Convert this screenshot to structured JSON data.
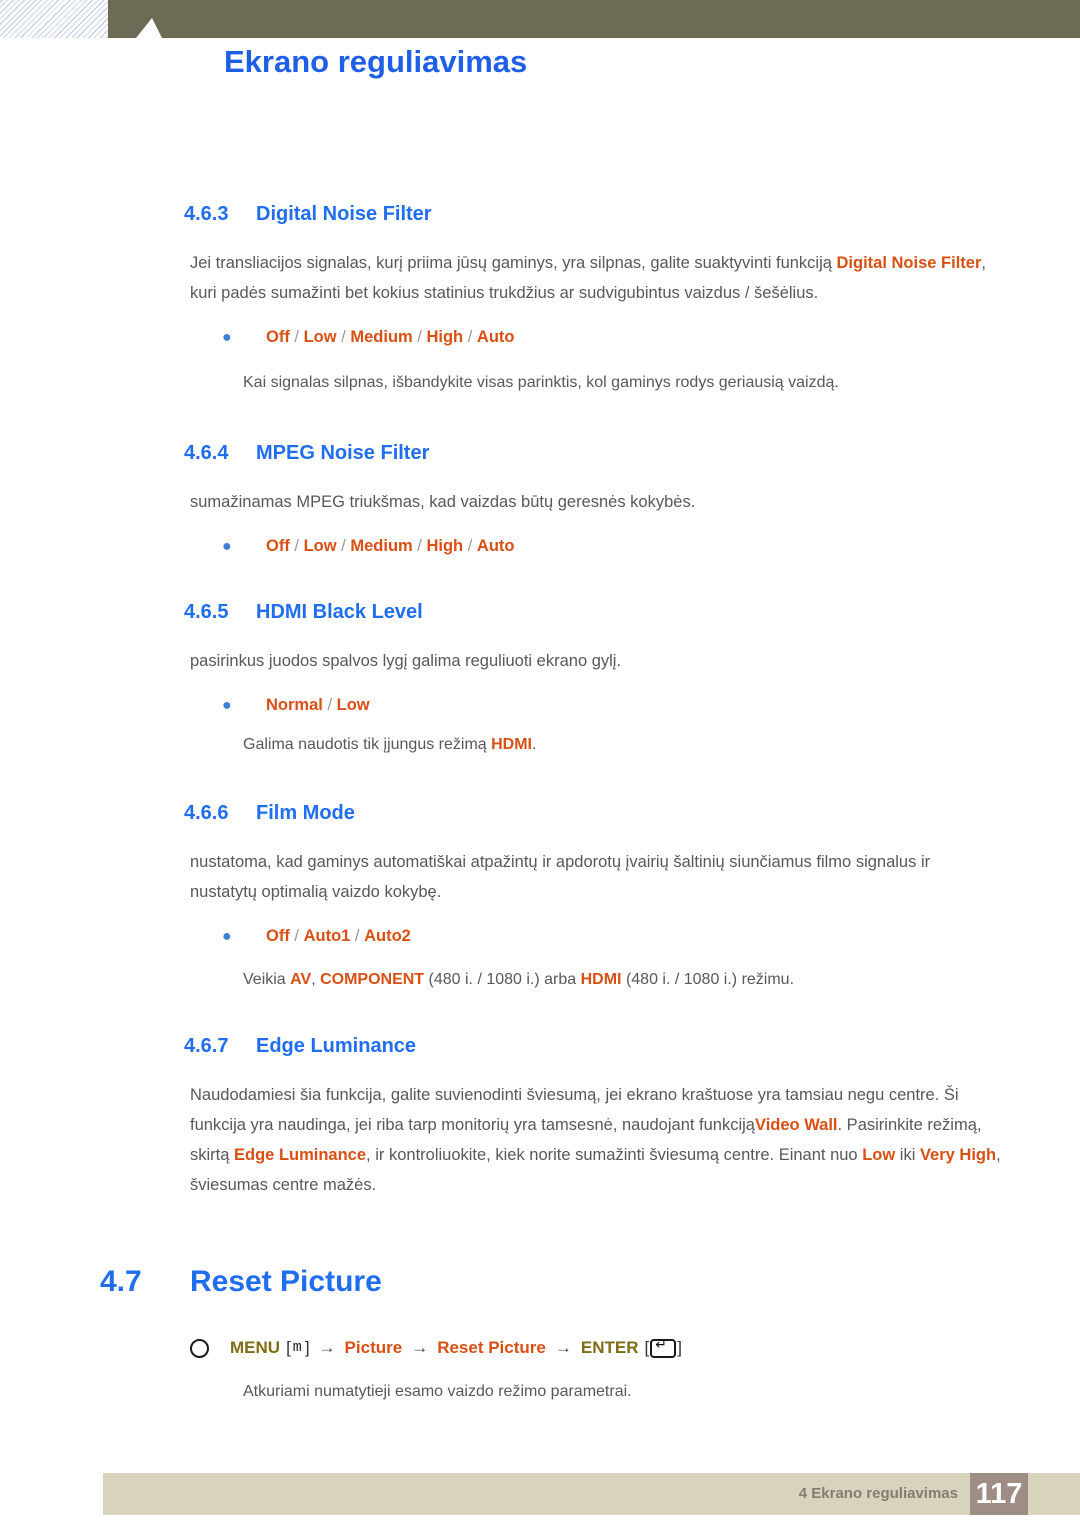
{
  "header": {
    "title": "Ekrano reguliavimas",
    "chapter_number": "4"
  },
  "sections": [
    {
      "number": "4.6.3",
      "title": "Digital Noise Filter",
      "paragraph_prefix": "Jei transliacijos signalas, kurį priima jūsų gaminys, yra silpnas, galite suaktyvinti funkciją ",
      "paragraph_highlight": "Digital Noise Filter",
      "paragraph_suffix": ", kuri padės sumažinti bet kokius statinius trukdžius ar sudvigubintus vaizdus / šešėlius.",
      "options": [
        "Off",
        "Low",
        "Medium",
        "High",
        "Auto"
      ],
      "note": "Kai signalas silpnas, išbandykite visas parinktis, kol gaminys rodys geriausią vaizdą."
    },
    {
      "number": "4.6.4",
      "title": "MPEG Noise Filter",
      "paragraph": "sumažinamas MPEG triukšmas, kad vaizdas būtų geresnės kokybės.",
      "options": [
        "Off",
        "Low",
        "Medium",
        "High",
        "Auto"
      ]
    },
    {
      "number": "4.6.5",
      "title": "HDMI Black Level",
      "paragraph": "pasirinkus juodos spalvos lygį galima reguliuoti ekrano gylį.",
      "options": [
        "Normal",
        "Low"
      ],
      "note_prefix": "Galima naudotis tik įjungus režimą ",
      "note_highlight": "HDMI",
      "note_suffix": "."
    },
    {
      "number": "4.6.6",
      "title": "Film Mode",
      "paragraph": "nustatoma, kad gaminys automatiškai atpažintų ir apdorotų įvairių šaltinių siunčiamus filmo signalus ir nustatytų optimalią vaizdo kokybę.",
      "options": [
        "Off",
        "Auto1",
        "Auto2"
      ],
      "note_parts": [
        {
          "text": "Veikia ",
          "highlight": false
        },
        {
          "text": "AV",
          "highlight": true
        },
        {
          "text": ", ",
          "highlight": false
        },
        {
          "text": "COMPONENT",
          "highlight": true
        },
        {
          "text": " (480 i. / 1080 i.) arba ",
          "highlight": false
        },
        {
          "text": "HDMI",
          "highlight": true
        },
        {
          "text": " (480 i. / 1080 i.) režimu.",
          "highlight": false
        }
      ]
    },
    {
      "number": "4.6.7",
      "title": "Edge Luminance",
      "paragraph_parts": [
        {
          "text": "Naudodamiesi šia funkcija, galite suvienodinti šviesumą, jei ekrano kraštuose yra tamsiau negu centre. Ši funkcija yra naudinga, jei riba tarp monitorių yra tamsesnė, naudojant funkciją",
          "highlight": false
        },
        {
          "text": "Video Wall",
          "highlight": true
        },
        {
          "text": ". Pasirinkite režimą, skirtą ",
          "highlight": false
        },
        {
          "text": "Edge Luminance",
          "highlight": true
        },
        {
          "text": ", ir kontroliuokite, kiek norite sumažinti šviesumą centre. Einant nuo ",
          "highlight": false
        },
        {
          "text": "Low",
          "highlight": true
        },
        {
          "text": " iki ",
          "highlight": false
        },
        {
          "text": "Very High",
          "highlight": true
        },
        {
          "text": ", šviesumas centre mažės.",
          "highlight": false
        }
      ]
    }
  ],
  "reset_section": {
    "number": "4.7",
    "title": "Reset Picture",
    "menu_path": {
      "bullet_icon": "circle-icon",
      "menu_label": "MENU",
      "bracket_open": "[",
      "menu_key": "m",
      "bracket_close": "]",
      "arrow": "→",
      "step1": "Picture",
      "step2": "Reset Picture",
      "enter_label": "ENTER",
      "enter_icon": "enter-key-icon"
    },
    "description": "Atkuriami numatytieji esamo vaizdo režimo parametrai."
  },
  "footer": {
    "label": "4 Ekrano reguliavimas",
    "page_number": "117"
  },
  "colors": {
    "heading_blue": "#1f6ef0",
    "highlight_orange": "#d94f14",
    "body_gray": "#58585a",
    "header_olive": "#6d6b56",
    "footer_beige": "#d8d3bd",
    "footer_page_box": "#9d8d84",
    "menu_olive": "#7d6d14"
  }
}
